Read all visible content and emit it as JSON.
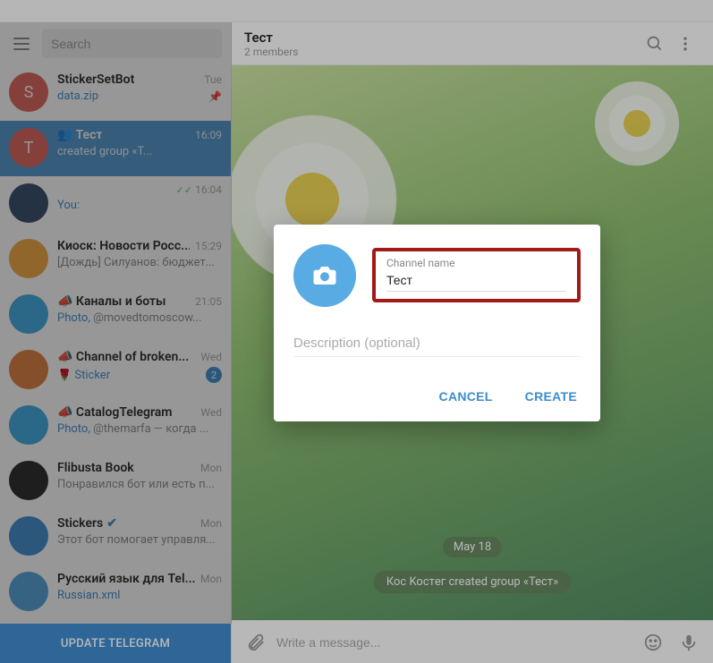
{
  "sidebar": {
    "search_placeholder": "Search",
    "update_label": "UPDATE TELEGRAM",
    "chats": [
      {
        "avatar_letter": "S",
        "avatar_bg": "#e05f56",
        "name": "StickerSetBot",
        "time": "Tue",
        "preview_blue": "data.zip",
        "preview_rest": "",
        "pin": true
      },
      {
        "avatar_letter": "T",
        "avatar_bg": "#e05f56",
        "name": "👥  Тест",
        "time": "16:09",
        "preview_blue": "",
        "preview_rest": "              created group «Т...",
        "active": true
      },
      {
        "avatar_letter": "",
        "avatar_bg": "#2f4766",
        "name": " ",
        "time": "16:04",
        "checks": true,
        "preview_blue": "You:",
        "preview_rest": " "
      },
      {
        "avatar_letter": "",
        "avatar_bg": "#f2a63b",
        "name": "Киоск: Новости Росс...",
        "time": "15:29",
        "preview_blue": "",
        "preview_rest": "[Дождь]  Силуанов: бюджет..."
      },
      {
        "avatar_letter": "",
        "avatar_bg": "#3aa7e0",
        "name": "📣 Каналы и боты",
        "time": "21:05",
        "preview_blue": "Photo,",
        "preview_rest": " @movedtomoscow..."
      },
      {
        "avatar_letter": "",
        "avatar_bg": "#e07b3a",
        "name": "📣 Channel of broken...",
        "time": "Wed",
        "preview_blue": "🌹 Sticker",
        "preview_rest": "",
        "badge": "2"
      },
      {
        "avatar_letter": "",
        "avatar_bg": "#3aa7e0",
        "name": "📣 CatalogTelegram",
        "time": "Wed",
        "preview_blue": "Photo,",
        "preview_rest": " @themarfa — когда ..."
      },
      {
        "avatar_letter": "",
        "avatar_bg": "#222",
        "name": "Flibusta Book",
        "time": "Mon",
        "preview_blue": "",
        "preview_rest": "Понравился бот или есть п..."
      },
      {
        "avatar_letter": "",
        "avatar_bg": "#3a8bd0",
        "name": "Stickers",
        "verified": true,
        "time": "Mon",
        "preview_blue": "",
        "preview_rest": "Этот бот помогает управля..."
      },
      {
        "avatar_letter": "",
        "avatar_bg": "#4ca0d8",
        "name": "Русский язык для Tel...",
        "time": "Mon",
        "preview_blue": "Russian.xml",
        "preview_rest": ""
      }
    ]
  },
  "main": {
    "title": "Тест",
    "subtitle": "2 members",
    "date_chip": "May 18",
    "system_chip": "Кос Kocтeг created group «Тест»",
    "compose_placeholder": "Write a message..."
  },
  "dialog": {
    "name_label": "Channel name",
    "name_value": "Тест",
    "desc_placeholder": "Description (optional)",
    "cancel": "CANCEL",
    "create": "CREATE"
  }
}
